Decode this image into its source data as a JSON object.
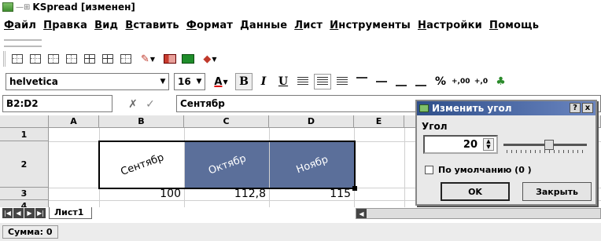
{
  "window": {
    "title": "KSpread [изменен]",
    "sys_button": "—⊞"
  },
  "menu": [
    {
      "mnemonic": "Ф",
      "rest": "айл"
    },
    {
      "mnemonic": "П",
      "rest": "равка"
    },
    {
      "mnemonic": "В",
      "rest": "ид"
    },
    {
      "mnemonic": "В",
      "rest": "ставить"
    },
    {
      "mnemonic": "Ф",
      "rest": "ормат"
    },
    {
      "mnemonic": "Д",
      "rest": "анные"
    },
    {
      "mnemonic": "Л",
      "rest": "ист"
    },
    {
      "mnemonic": "И",
      "rest": "нструменты"
    },
    {
      "mnemonic": "Н",
      "rest": "астройки"
    },
    {
      "mnemonic": "П",
      "rest": "омощь"
    }
  ],
  "format_toolbar": {
    "font": "helvetica",
    "size": "16",
    "bold": "B",
    "italic": "I",
    "underline": "U",
    "text_color": "A",
    "percent": "%",
    "inc_precision": "+,00",
    "dec_precision": "+,0"
  },
  "formula_bar": {
    "cell_ref": "B2:D2",
    "content": "Сентябр"
  },
  "sheet": {
    "columns": [
      "A",
      "B",
      "C",
      "D",
      "E"
    ],
    "rows": [
      "1",
      "2",
      "3",
      "4"
    ],
    "row2": [
      "Сентябр",
      "Октябр",
      "Ноябр"
    ],
    "row3": [
      "100",
      "112,8",
      "115"
    ]
  },
  "tabs": {
    "sheet_tab": "Лист1"
  },
  "status": {
    "sum": "Сумма: 0"
  },
  "dialog": {
    "title": "Изменить угол",
    "help": "?",
    "close_x": "x",
    "angle_label": "Угол",
    "angle_value": "20",
    "slider_fraction": 0.55,
    "default_label": "По умолчанию (0 )",
    "ok_label": "OK",
    "close_label": "Закрыть"
  },
  "colors": {
    "selection": "#5b6f9a",
    "dialog_title_start": "#2f4f8a",
    "dialog_title_end": "#6a85c0"
  }
}
